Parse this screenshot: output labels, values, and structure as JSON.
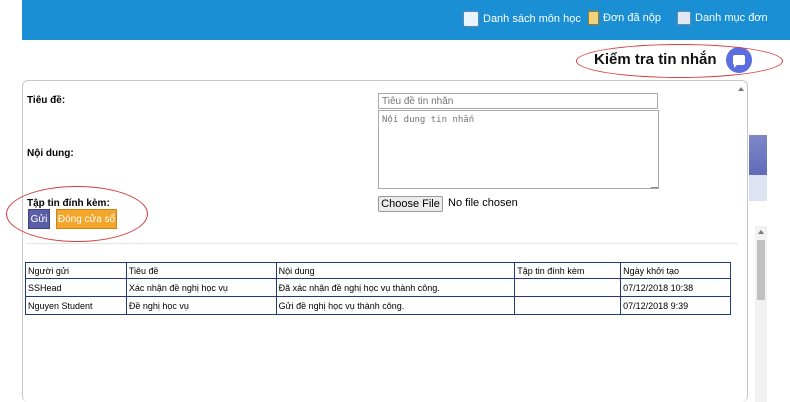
{
  "nav": {
    "items": [
      {
        "label": "Danh sách môn học",
        "icon": "course-list-icon"
      },
      {
        "label": "Đơn đã nộp",
        "icon": "document-icon"
      },
      {
        "label": "Danh mục đơn",
        "icon": "folder-icon"
      }
    ]
  },
  "check_messages": {
    "label": "Kiểm tra tin nhắn",
    "icon": "message-bubble-icon"
  },
  "form": {
    "title_label": "Tiêu đề:",
    "title_placeholder": "Tiêu đề tin nhắn",
    "content_label": "Nội dung:",
    "content_placeholder": "Nội dung tin nhắn",
    "attachment_label": "Tập tin đính kèm:",
    "choose_file": "Choose File",
    "file_status": "No file chosen",
    "send_button": "Gửi",
    "close_button": "Đóng cửa sổ"
  },
  "table": {
    "headers": [
      "Người gửi",
      "Tiêu đề",
      "Nội dung",
      "Tập tin đính kèm",
      "Ngày khởi tạo"
    ],
    "rows": [
      [
        "SSHead",
        "Xác nhận đề nghị học vụ",
        "Đã xác nhận đề nghị học vụ thành công.",
        "",
        "07/12/2018 10:38"
      ],
      [
        "Nguyen Student",
        "Đề nghị học vụ",
        "Gửi đề nghị học vụ thành công.",
        "",
        "07/12/2018 9:39"
      ]
    ]
  },
  "colors": {
    "topbar": "#1a8fd4",
    "send_button": "#5a5fa5",
    "close_button": "#f4a62b",
    "fab": "#5b6ee1",
    "highlight_ellipse": "#d83a3a"
  }
}
